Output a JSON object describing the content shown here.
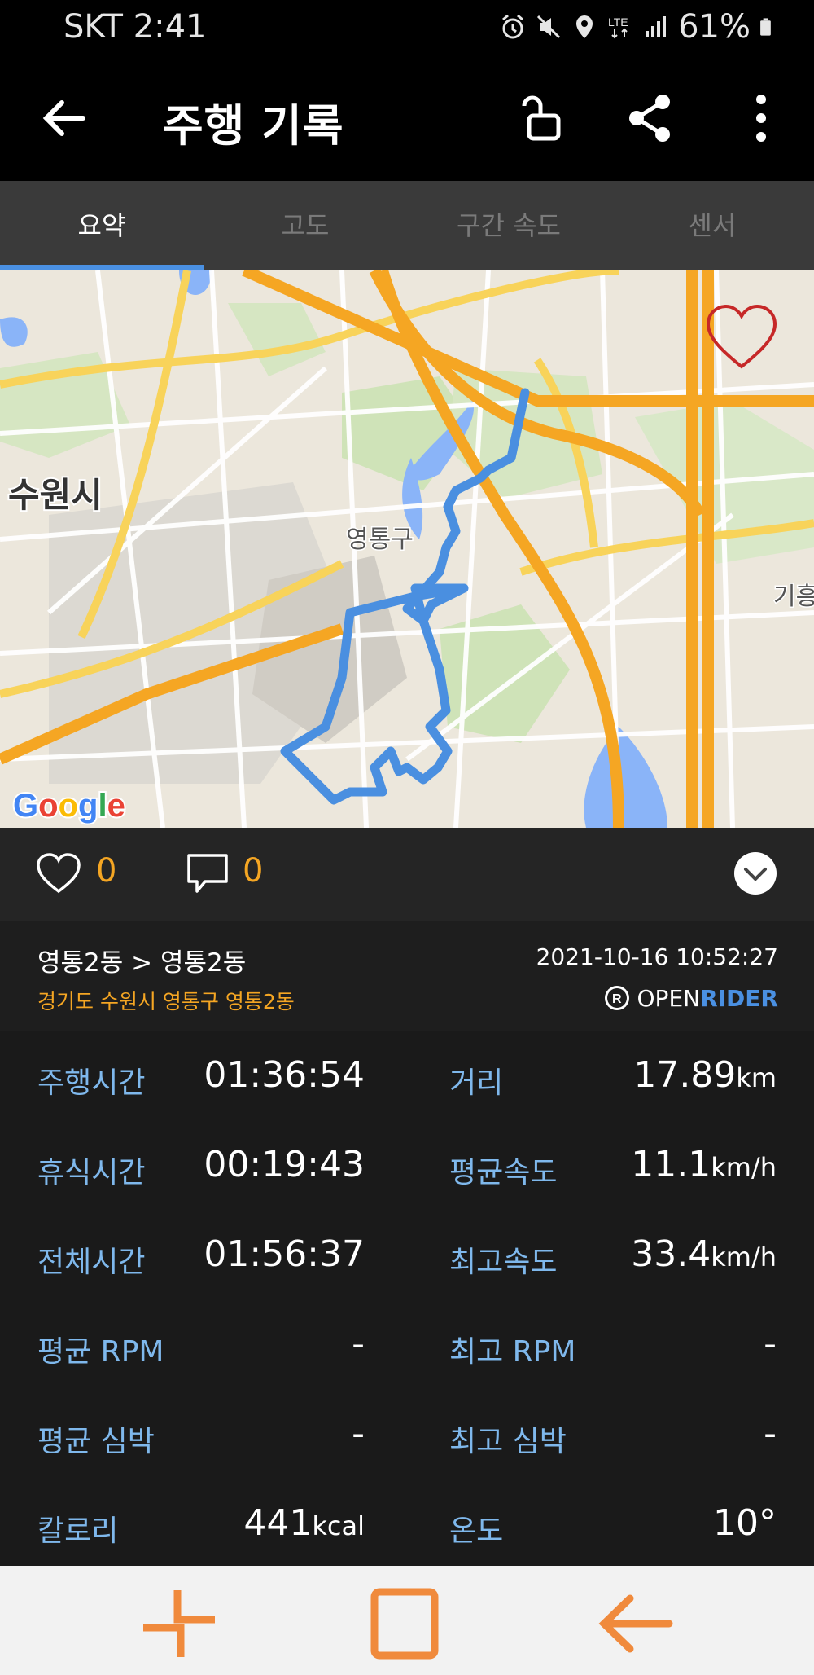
{
  "status_bar": {
    "time": "SKT 2:41",
    "battery": "61%",
    "icons": [
      "alarm-icon",
      "mute-icon",
      "location-icon",
      "lte-icon",
      "signal-icon",
      "battery-icon"
    ]
  },
  "app_bar": {
    "title": "주행 기록",
    "icons": [
      "back-arrow-icon",
      "unlock-icon",
      "share-icon",
      "more-vert-icon"
    ]
  },
  "tabs": [
    {
      "label": "요약",
      "active": true
    },
    {
      "label": "고도",
      "active": false
    },
    {
      "label": "구간 속도",
      "active": false
    },
    {
      "label": "센서",
      "active": false
    }
  ],
  "map": {
    "labels": {
      "city": "수원시",
      "district": "영통구",
      "edge": "기흥"
    },
    "google_logo": "Google",
    "route_color": "#4a8fe0"
  },
  "social": {
    "likes": "0",
    "comments": "0"
  },
  "ride_info": {
    "route": "영통2동 > 영통2동",
    "address": "경기도 수원시 영통구 영통2동",
    "datetime": "2021-10-16 10:52:27",
    "brand_open": "OPEN",
    "brand_rider": "RIDER"
  },
  "stats": {
    "riding_time_label": "주행시간",
    "riding_time": "01:36:54",
    "distance_label": "거리",
    "distance": "17.89",
    "distance_unit": "km",
    "rest_time_label": "휴식시간",
    "rest_time": "00:19:43",
    "avg_speed_label": "평균속도",
    "avg_speed": "11.1",
    "avg_speed_unit": "km/h",
    "total_time_label": "전체시간",
    "total_time": "01:56:37",
    "max_speed_label": "최고속도",
    "max_speed": "33.4",
    "max_speed_unit": "km/h",
    "avg_rpm_label": "평균 RPM",
    "avg_rpm": "-",
    "max_rpm_label": "최고 RPM",
    "max_rpm": "-",
    "avg_hr_label": "평균 심박",
    "avg_hr": "-",
    "max_hr_label": "최고 심박",
    "max_hr": "-",
    "calories_label": "칼로리",
    "calories": "441",
    "calories_unit": "kcal",
    "temperature_label": "온도",
    "temperature": "10°"
  },
  "colors": {
    "accent": "#4a90e2",
    "orange": "#f5a623",
    "stat_label": "#7fb8ec",
    "nav_icon": "#f08a3c"
  },
  "nav_icons": [
    "recent-apps-icon",
    "home-icon",
    "back-icon"
  ]
}
